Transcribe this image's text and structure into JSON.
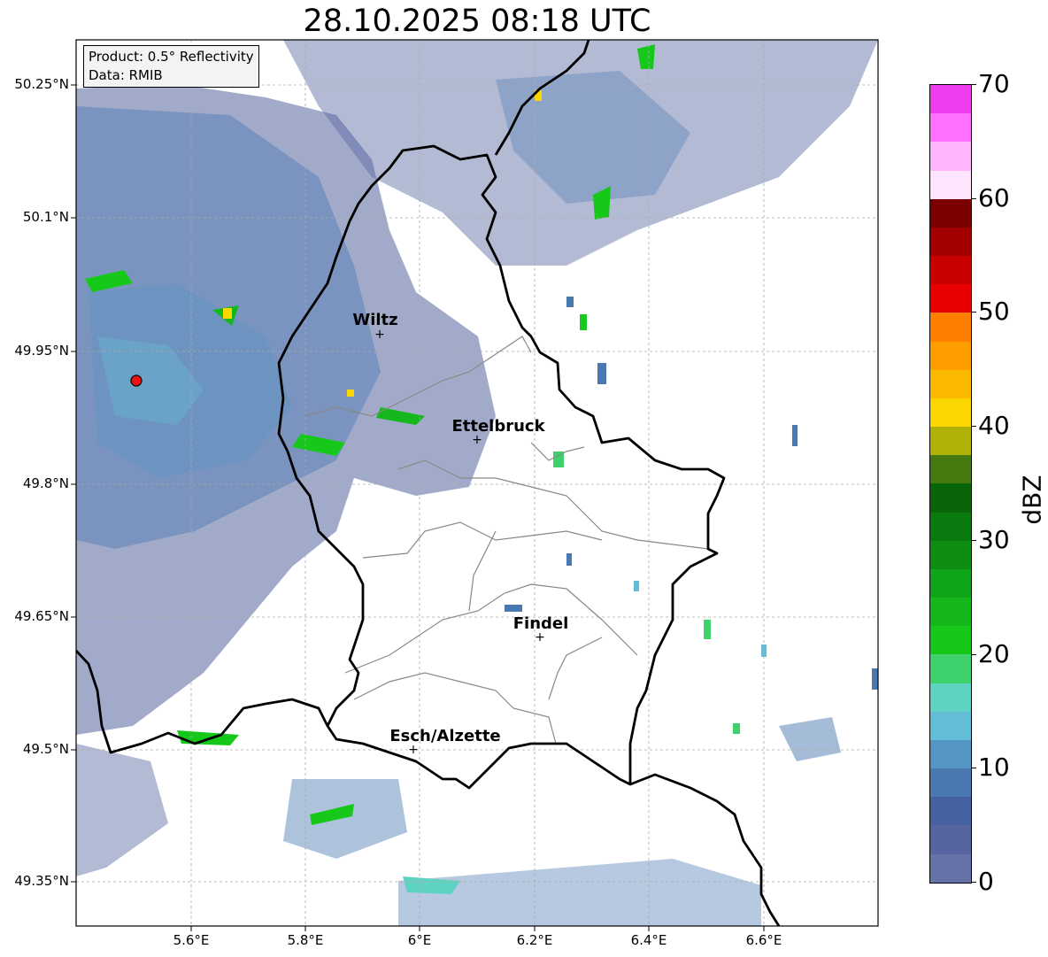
{
  "title": "28.10.2025 08:18 UTC",
  "info": {
    "line1": "Product: 0.5° Reflectivity",
    "line2": "Data: RMIB"
  },
  "lat_labels": [
    "50.25°N",
    "50.1°N",
    "49.95°N",
    "49.8°N",
    "49.65°N",
    "49.5°N",
    "49.35°N"
  ],
  "lon_labels": [
    "5.6°E",
    "5.8°E",
    "6°E",
    "6.2°E",
    "6.4°E",
    "6.6°E"
  ],
  "cities": [
    "Wiltz",
    "Ettelbruck",
    "Findel",
    "Esch/Alzette"
  ],
  "radar_site_color": "#ee1111",
  "colorbar": {
    "unit": "dBZ",
    "ticks": [
      "0",
      "10",
      "20",
      "30",
      "40",
      "50",
      "60",
      "70"
    ],
    "colors": [
      "#6573a8",
      "#56659f",
      "#4561a2",
      "#4a79b2",
      "#5595c4",
      "#63bdd6",
      "#5fd3c2",
      "#3fd26c",
      "#16c81a",
      "#14b81c",
      "#10a418",
      "#0d8e12",
      "#0a7a0e",
      "#0a650a",
      "#447a10",
      "#b0b20a",
      "#fcd600",
      "#fdb800",
      "#fe9d00",
      "#fe7f00",
      "#e80000",
      "#c80000",
      "#a20000",
      "#7a0000",
      "#ffe4fe",
      "#ffb4fe",
      "#ff70fc",
      "#ee3cee"
    ]
  }
}
